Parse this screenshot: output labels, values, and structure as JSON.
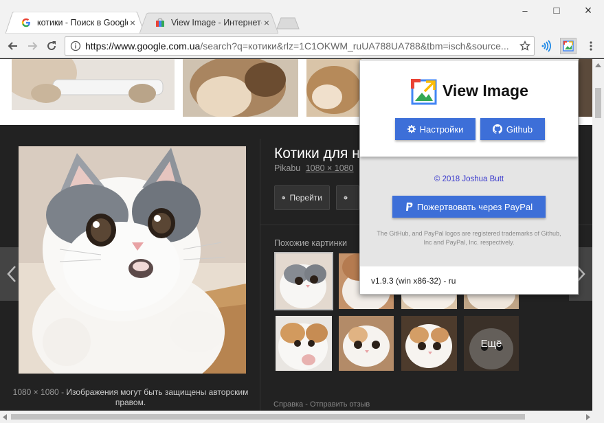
{
  "browser": {
    "tabs": [
      {
        "title": "котики - Поиск в Google",
        "close": "×",
        "active": true
      },
      {
        "title": "View Image - Интернет-магазин Chrome",
        "close": "×",
        "active": false
      }
    ],
    "window_controls": {
      "minimize": "–",
      "maximize": "□",
      "close": "×"
    },
    "omnibox": {
      "url_host": "https://www.google.com.ua",
      "url_rest": "/search?q=котики&rlz=1C1OKWM_ruUA788UA788&tbm=isch&source..."
    }
  },
  "viewer": {
    "caption_size": "1080 × 1080",
    "caption_sep": "-",
    "caption_text": "Изображения могут быть защищены авторским правом.",
    "title": "Котики для настроения",
    "source": "Pikabu",
    "size_link": "1080 × 1080",
    "visit_label": "Перейти",
    "similar_label": "Похожие картинки",
    "more_label": "Ещё",
    "footer_help": "Справка",
    "footer_sep": "-",
    "footer_feedback": "Отправить отзыв"
  },
  "popup": {
    "title": "View Image",
    "settings_label": "Настройки",
    "github_label": "Github",
    "copyright": "© 2018 Joshua Butt",
    "paypal_label": "Пожертвовать через PayPal",
    "legal": "The GitHub, and PayPal logos are registered trademarks of Github, Inc and PayPal, Inc. respectively.",
    "version": "v1.9.3 (win x86-32) - ru"
  },
  "colors": {
    "accent_button": "#3d6fd8",
    "viewer_bg": "#222222"
  }
}
